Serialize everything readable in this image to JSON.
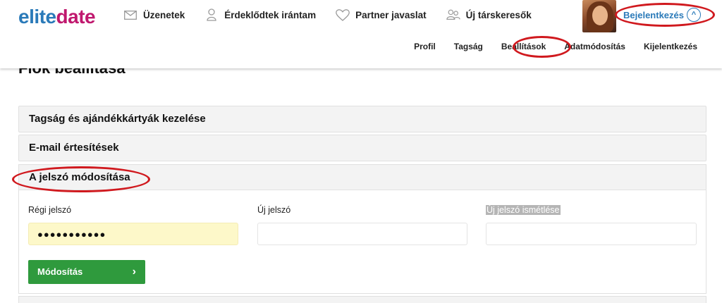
{
  "logo": {
    "part1": "elite",
    "part2": "date"
  },
  "nav": [
    {
      "icon": "envelope-icon",
      "label": "Üzenetek"
    },
    {
      "icon": "person-icon",
      "label": "Érdeklődtek irántam"
    },
    {
      "icon": "heart-icon",
      "label": "Partner javaslat"
    },
    {
      "icon": "people-icon",
      "label": "Új társkeresők"
    }
  ],
  "account": {
    "login_label": "Bejelentkezés",
    "chevron": "^"
  },
  "subnav": [
    "Profil",
    "Tagság",
    "Beállítások",
    "Adatmódosítás",
    "Kijelentkezés"
  ],
  "page": {
    "title": "Fiók beállítása"
  },
  "sections": [
    "Tagság és ajándékkártyák kezelése",
    "E-mail értesítések",
    "A jelszó módosítása"
  ],
  "password_form": {
    "old_label": "Régi jelszó",
    "old_value": "●●●●●●●●●●●",
    "new_label": "Új jelszó",
    "repeat_label": "Új jelszó ismétlése",
    "submit_label": "Módosítás",
    "submit_arrow": "›"
  },
  "colors": {
    "brand_blue": "#2a7ab9",
    "brand_magenta": "#c0186e",
    "button_green": "#2f9a3d",
    "annotation_red": "#d0191e"
  }
}
